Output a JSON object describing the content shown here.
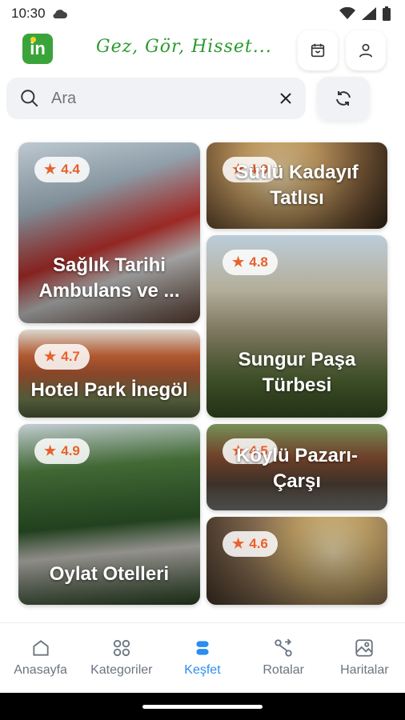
{
  "status": {
    "time": "10:30"
  },
  "header": {
    "logo_text": "in",
    "slogan": "Gez, Gör, Hisset..."
  },
  "search": {
    "placeholder": "Ara",
    "value": ""
  },
  "cards": [
    {
      "title": "Sağlık Tarihi Ambulans ve ...",
      "rating": "4.4"
    },
    {
      "title": "Sütlü Kadayıf Tatlısı",
      "rating": "4.0"
    },
    {
      "title": "Sungur Paşa Türbesi",
      "rating": "4.8"
    },
    {
      "title": "Hotel Park İnegöl",
      "rating": "4.7"
    },
    {
      "title": "Oylat Otelleri",
      "rating": "4.9"
    },
    {
      "title": "Köylü Pazarı-Çarşı",
      "rating": "4.5"
    },
    {
      "title": "",
      "rating": "4.6"
    }
  ],
  "nav": {
    "home": "Anasayfa",
    "categories": "Kategoriler",
    "discover": "Keşfet",
    "routes": "Rotalar",
    "maps": "Haritalar"
  },
  "colors": {
    "accent": "#2b8df0",
    "brand": "#3aa43a",
    "star": "#e8612d"
  }
}
